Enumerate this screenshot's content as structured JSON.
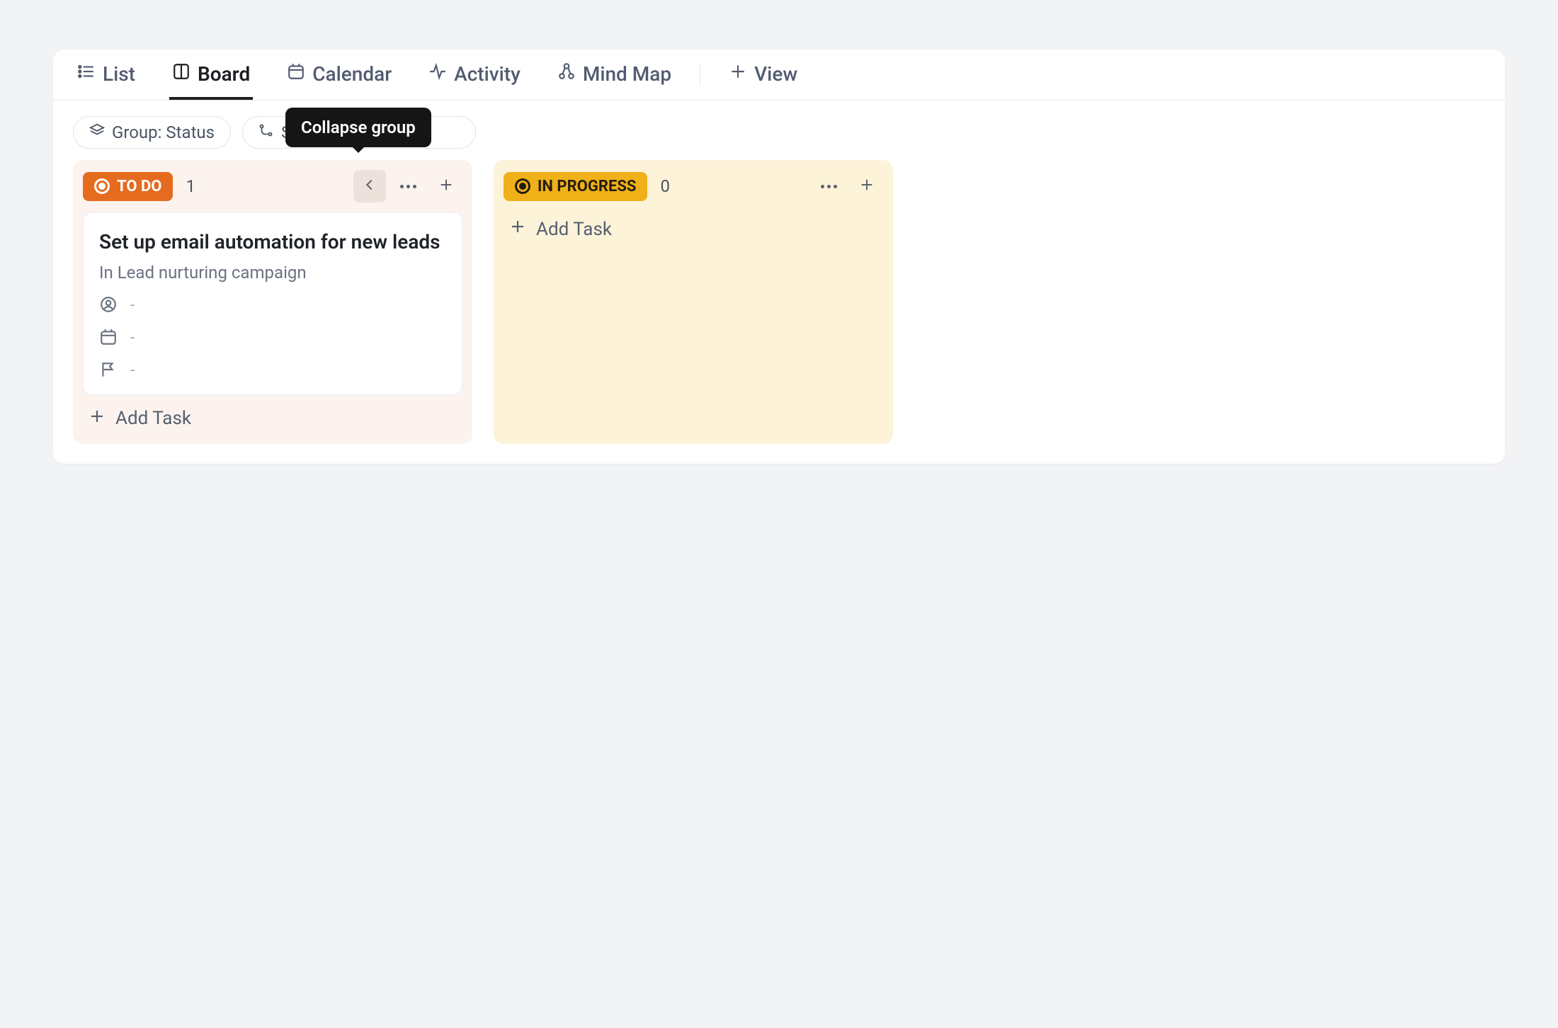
{
  "tabs": {
    "list": "List",
    "board": "Board",
    "calendar": "Calendar",
    "activity": "Activity",
    "mindmap": "Mind Map",
    "add_view": "View"
  },
  "filters": {
    "group": "Group: Status",
    "subtasks_partial": "S"
  },
  "tooltip": {
    "collapse_group": "Collapse group"
  },
  "columns": {
    "todo": {
      "label": "TO DO",
      "count": "1"
    },
    "in_progress": {
      "label": "IN PROGRESS",
      "count": "0"
    }
  },
  "card": {
    "title": "Set up email automation for new leads",
    "list_context": "In Lead nurturing campaign",
    "assignee_value": "-",
    "date_value": "-",
    "priority_value": "-"
  },
  "actions": {
    "add_task": "Add Task"
  }
}
